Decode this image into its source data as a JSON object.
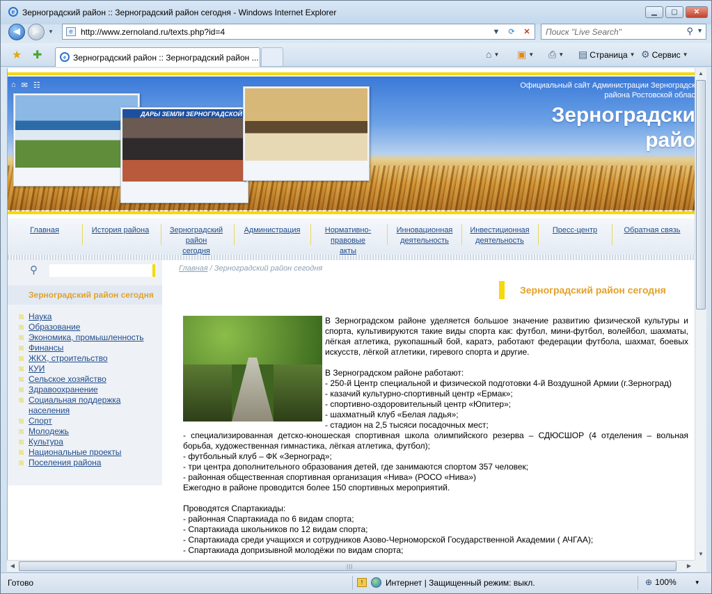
{
  "browser": {
    "window_title": "Зерноградский район :: Зерноградский район сегодня - Windows Internet Explorer",
    "address": "http://www.zernoland.ru/texts.php?id=4",
    "search_placeholder": "Поиск \"Live Search\"",
    "tab_title": "Зерноградский район :: Зерноградский район ...",
    "page_menu": "Страница",
    "service_menu": "Сервис",
    "status": "Готово",
    "zone": "Интернет | Защищенный режим: выкл.",
    "zoom": "100%"
  },
  "site": {
    "official_line1": "Официальный сайт Администрации Зерноградск",
    "official_line2": "района Ростовской облас",
    "title_line1": "Зерноградски",
    "title_line2": "райо",
    "photo_banner": "ДАРЫ ЗЕМЛИ ЗЕРНОГРАДСКОЙ"
  },
  "menu": [
    {
      "line1": "Главная",
      "line2": "",
      "line3": ""
    },
    {
      "line1": "История района",
      "line2": "",
      "line3": ""
    },
    {
      "line1": "Зерноградский",
      "line2": "район",
      "line3": "сегодня"
    },
    {
      "line1": "Администрация",
      "line2": "",
      "line3": ""
    },
    {
      "line1": "Нормативно-",
      "line2": "правовые",
      "line3": "акты"
    },
    {
      "line1": "Инновационная",
      "line2": "деятельность",
      "line3": ""
    },
    {
      "line1": "Инвестиционная",
      "line2": "деятельность",
      "line3": ""
    },
    {
      "line1": "Пресс-центр",
      "line2": "",
      "line3": ""
    },
    {
      "line1": "Обратная связь",
      "line2": "",
      "line3": ""
    }
  ],
  "sidebar": {
    "heading": "Зерноградский район сегодня",
    "items": [
      "Наука",
      "Образование",
      "Экономика, промышленность",
      "Финансы",
      "ЖКХ, строительство",
      "КУИ",
      "Сельское хозяйство",
      "Здравоохранение",
      "Социальная поддержка",
      "населения",
      "Спорт",
      "Молодежь",
      "Культура",
      "Национальные проекты",
      "Поселения района"
    ]
  },
  "breadcrumb": {
    "home": "Главная",
    "sep": " / ",
    "current": "Зерноградский район сегодня"
  },
  "page_title": "Зерноградский район сегодня",
  "article": {
    "p1": "В Зерноградском районе уделяется большое значение развитию физической культуры и спорта, культивируются такие виды спорта как: футбол, мини-футбол, волейбол, шахматы, лёгкая атлетика, рукопашный бой, каратэ, работают федерации футбола, шахмат, боевых искусств, лёгкой атлетики, гиревого спорта и другие.",
    "p2": "В Зерноградском районе работают:",
    "l1": "- 250-й  Центр специальной и физической подготовки 4-й Воздушной Армии (г.Зерноград)",
    "l2": "- казачий культурно-спортивный центр «Ермак»;",
    "l3": "- спортивно-оздоровительный центр «Юпитер»;",
    "l4": "- шахматный клуб «Белая ладья»;",
    "l5": "- стадион на 2,5 тысяси посадочных мест;",
    "l6": "-  специализированная детско-юношеская спортивная школа олимпийского резерва – СДЮСШОР (4 отделения – вольная борьба, художественная гимнастика, лёгкая атлетика, футбол);",
    "l7": "- футбольный клуб – ФК «Зерноград»;",
    "l8": "- три центра дополнительного образования детей, где занимаются спортом 357 человек;",
    "l9": "- районная общественная спортивная организация «Нива» (РОСО «Нива»)",
    "l10": "Ежегодно в районе проводится  более 150 спортивных  мероприятий.",
    "p3": "Проводятся Спартакиады:",
    "s1": "- районная Спартакиада по 6 видам спорта;",
    "s2": "- Спартакиада школьников по 12 видам спорта;",
    "s3": "- Спартакиада среди учащихся и сотрудников Азово-Черноморской Государственной Академии ( АЧГАА);",
    "s4": "- Спартакиада допризывной молодёжи по видам спорта;"
  }
}
